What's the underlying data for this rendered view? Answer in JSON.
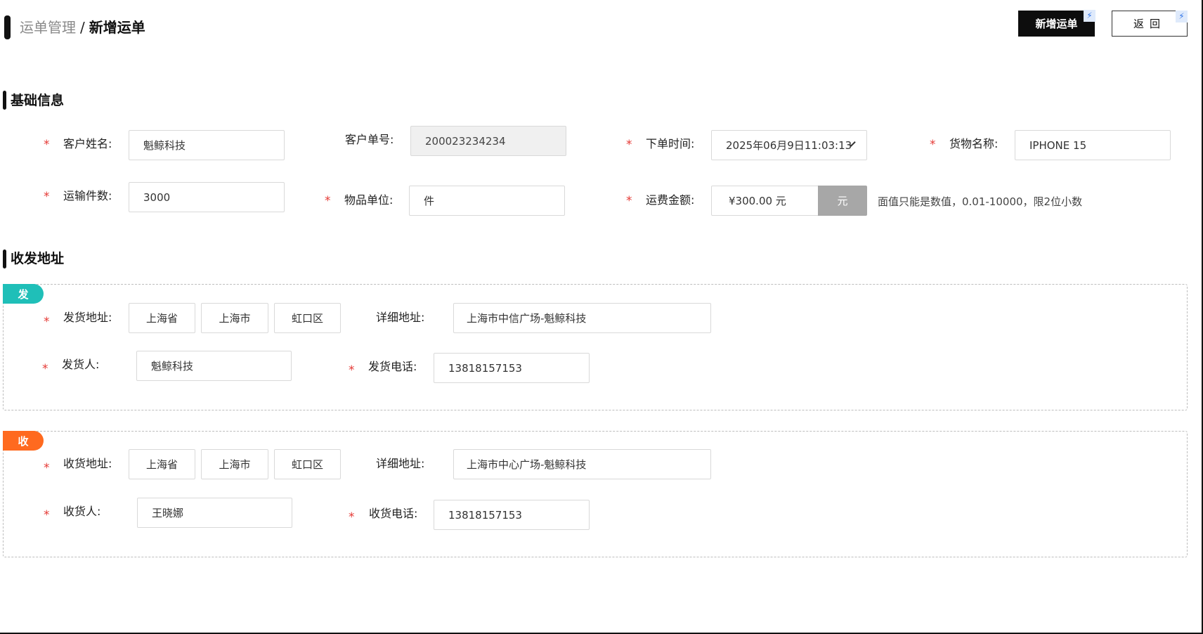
{
  "breadcrumb": {
    "parent": "运单管理",
    "separator": "/",
    "current": "新增运单"
  },
  "header": {
    "add_button": "新增运单",
    "back_button": "返回"
  },
  "sections": {
    "basic": "基础信息",
    "address": "收发地址"
  },
  "basic": {
    "customer_name": {
      "label": "客户姓名:",
      "value": "魁鲸科技"
    },
    "customer_no": {
      "label": "客户单号:",
      "value": "200023234234"
    },
    "order_time": {
      "label": "下单时间:",
      "value": "2025年06月9日11:03:13"
    },
    "goods_name": {
      "label": "货物名称:",
      "value": "IPHONE 15"
    },
    "quantity": {
      "label": "运输件数:",
      "value": "3000"
    },
    "unit": {
      "label": "物品单位:",
      "value": "件"
    },
    "freight": {
      "label": "运费金额:",
      "value": "¥300.00 元",
      "unit_button": "元",
      "hint": "面值只能是数值，0.01-10000，限2位小数"
    }
  },
  "sender": {
    "tag": "发",
    "address": {
      "label": "发货地址:",
      "province": "上海省",
      "city": "上海市",
      "district": "虹口区"
    },
    "detail": {
      "label": "详细地址:",
      "value": "上海市中信广场-魁鲸科技"
    },
    "person": {
      "label": "发货人:",
      "value": "魁鲸科技"
    },
    "phone": {
      "label": "发货电话:",
      "value": "13818157153"
    }
  },
  "receiver": {
    "tag": "收",
    "address": {
      "label": "收货地址:",
      "province": "上海省",
      "city": "上海市",
      "district": "虹口区"
    },
    "detail": {
      "label": "详细地址:",
      "value": "上海市中心广场-魁鲸科技"
    },
    "person": {
      "label": "收货人:",
      "value": "王晓娜"
    },
    "phone": {
      "label": "收货电话:",
      "value": "13818157153"
    }
  },
  "icons": {
    "bolt": "lightning-icon",
    "chevron": "chevron-down-icon",
    "required": "*"
  },
  "colors": {
    "primary": "#0d0d0d",
    "sender_tag": "#1fbfb8",
    "receiver_tag": "#ff6a1f",
    "required": "#e53935",
    "unit_button": "#a7a7a7"
  }
}
